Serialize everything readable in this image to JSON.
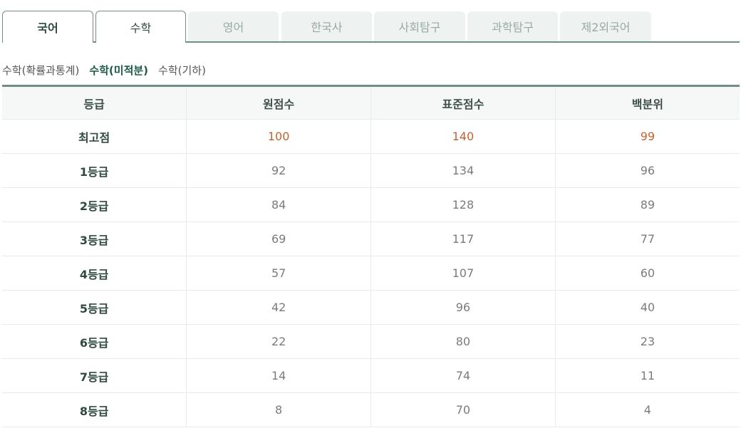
{
  "tabs": [
    {
      "label": "국어"
    },
    {
      "label": "수학"
    },
    {
      "label": "영어"
    },
    {
      "label": "한국사"
    },
    {
      "label": "사회탐구"
    },
    {
      "label": "과학탐구"
    },
    {
      "label": "제2외국어"
    }
  ],
  "subtabs": [
    {
      "label": "수학(확률과통계)"
    },
    {
      "label": "수학(미적분)"
    },
    {
      "label": "수학(기하)"
    }
  ],
  "table": {
    "headers": [
      "등급",
      "원점수",
      "표준점수",
      "백분위"
    ],
    "rows": [
      [
        "최고점",
        "100",
        "140",
        "99"
      ],
      [
        "1등급",
        "92",
        "134",
        "96"
      ],
      [
        "2등급",
        "84",
        "128",
        "89"
      ],
      [
        "3등급",
        "69",
        "117",
        "77"
      ],
      [
        "4등급",
        "57",
        "107",
        "60"
      ],
      [
        "5등급",
        "42",
        "96",
        "40"
      ],
      [
        "6등급",
        "22",
        "80",
        "23"
      ],
      [
        "7등급",
        "14",
        "74",
        "11"
      ],
      [
        "8등급",
        "8",
        "70",
        "4"
      ]
    ]
  },
  "colors": {
    "accent": "#6f8f85",
    "highlight_value": "#c8602e",
    "active_subtab": "#1f5a47"
  }
}
